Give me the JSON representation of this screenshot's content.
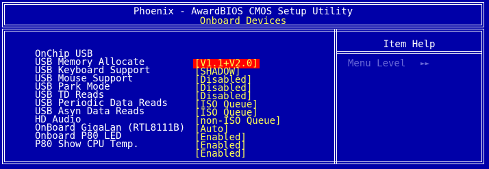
{
  "header": {
    "title": "Phoenix - AwardBIOS CMOS Setup Utility",
    "subtitle": "Onboard Devices"
  },
  "settings": [
    {
      "label": "OnChip USB",
      "value": "[V1.1+V2.0]",
      "selected": true
    },
    {
      "label": "USB Memory Allocate",
      "value": "[SHADOW]"
    },
    {
      "label": "USB Keyboard Support",
      "value": "[Disabled]"
    },
    {
      "label": "USB Mouse Support",
      "value": "[Disabled]"
    },
    {
      "label": "USB Park Mode",
      "value": "[Disabled]"
    },
    {
      "label": "USB TD Reads",
      "value": "[ISO Queue]"
    },
    {
      "label": "USB Periodic Data Reads",
      "value": "[ISO Queue]"
    },
    {
      "label": "USB Asyn Data Reads",
      "value": "[non-ISO Queue]"
    },
    {
      "label": "HD Audio",
      "value": "[Auto]"
    },
    {
      "label": "OnBoard GigaLan (RTL8111B)",
      "value": "[Enabled]"
    },
    {
      "label": "Onboard P80 LED",
      "value": "[Enabled]"
    },
    {
      "label": "P80 Show CPU Temp.",
      "value": "[Enabled]"
    }
  ],
  "help": {
    "title": "Item Help",
    "menu_level_label": "Menu Level",
    "menu_level_arrows": "►►"
  },
  "colors": {
    "background": "#0000a8",
    "value_text": "#ffff55",
    "highlight": "#ff0000",
    "dim_text": "#6a6ad8"
  }
}
